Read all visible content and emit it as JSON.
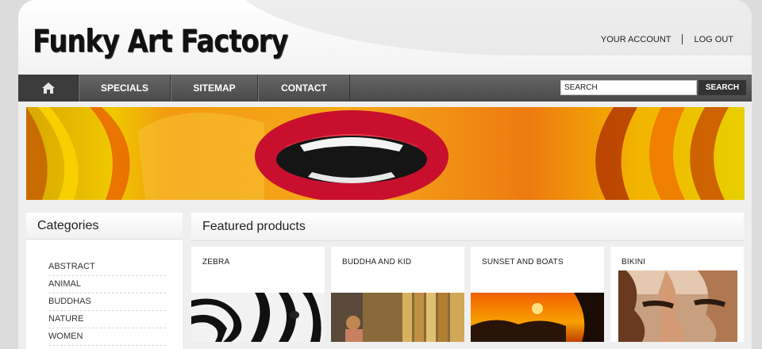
{
  "header": {
    "logo_text": "Funky Art Factory",
    "account_link": "YOUR ACCOUNT",
    "logout_link": "LOG OUT"
  },
  "nav": {
    "home_icon": "home-icon",
    "items": [
      "SPECIALS",
      "SITEMAP",
      "CONTACT"
    ],
    "search_placeholder": "SEARCH",
    "search_button": "SEARCH"
  },
  "sidebar": {
    "title": "Categories",
    "categories": [
      "ABSTRACT",
      "ANIMAL",
      "BUDDHAS",
      "NATURE",
      "WOMEN"
    ]
  },
  "featured": {
    "title": "Featured products",
    "products": [
      {
        "name": "ZEBRA"
      },
      {
        "name": "BUDDHA AND KID"
      },
      {
        "name": "SUNSET AND BOATS"
      },
      {
        "name": "BIKINI"
      }
    ]
  },
  "colors": {
    "nav_bg": "#555555",
    "page_bg": "#efefef",
    "lips_red": "#c8102e"
  }
}
